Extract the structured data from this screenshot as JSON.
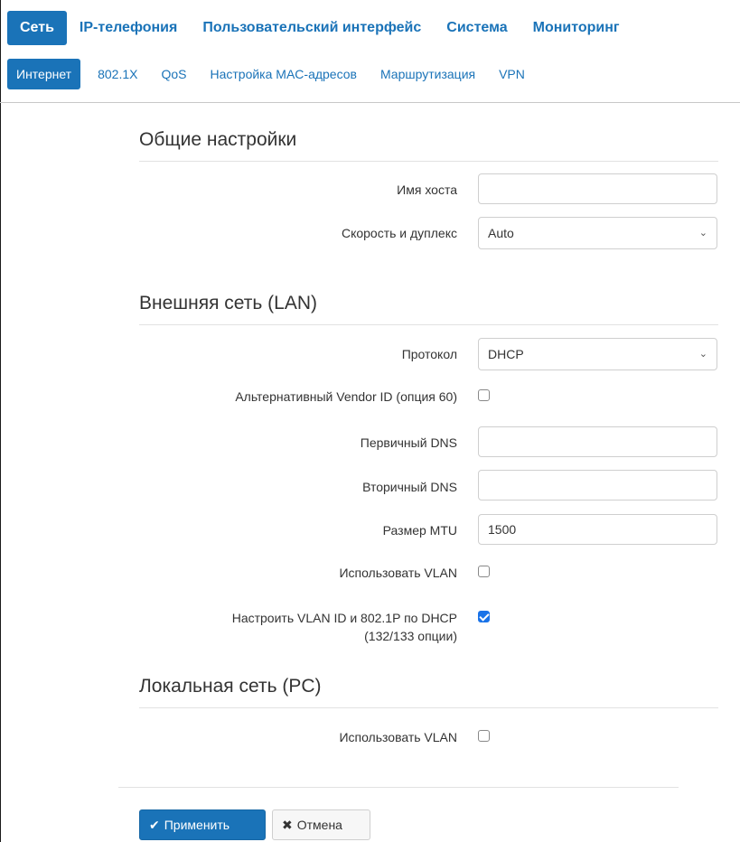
{
  "top_nav": [
    {
      "label": "Сеть",
      "active": true
    },
    {
      "label": "IP-телефония",
      "active": false
    },
    {
      "label": "Пользовательский интерфейс",
      "active": false
    },
    {
      "label": "Система",
      "active": false
    },
    {
      "label": "Мониторинг",
      "active": false
    }
  ],
  "sub_nav": [
    {
      "label": "Интернет",
      "active": true
    },
    {
      "label": "802.1X",
      "active": false
    },
    {
      "label": "QoS",
      "active": false
    },
    {
      "label": "Настройка MAC-адресов",
      "active": false
    },
    {
      "label": "Маршрутизация",
      "active": false
    },
    {
      "label": "VPN",
      "active": false
    }
  ],
  "general": {
    "title": "Общие настройки",
    "hostname_label": "Имя хоста",
    "hostname_value": "",
    "speed_label": "Скорость и дуплекс",
    "speed_value": "Auto"
  },
  "wan": {
    "title": "Внешняя сеть (LAN)",
    "protocol_label": "Протокол",
    "protocol_value": "DHCP",
    "vendor_id_label": "Альтернативный Vendor ID (опция 60)",
    "vendor_id_checked": false,
    "dns1_label": "Первичный DNS",
    "dns1_value": "",
    "dns2_label": "Вторичный DNS",
    "dns2_value": "",
    "mtu_label": "Размер MTU",
    "mtu_value": "1500",
    "use_vlan_label": "Использовать VLAN",
    "use_vlan_checked": false,
    "vlan_dhcp_label_line1": "Настроить VLAN ID и 802.1P по DHCP",
    "vlan_dhcp_label_line2": "(132/133 опции)",
    "vlan_dhcp_checked": true
  },
  "lan": {
    "title": "Локальная сеть (PC)",
    "use_vlan_label": "Использовать VLAN",
    "use_vlan_checked": false
  },
  "buttons": {
    "apply_label": "Применить",
    "cancel_label": "Отмена"
  },
  "colors": {
    "accent": "#1a73b8",
    "checkbox_checked": "#1a73e8"
  }
}
